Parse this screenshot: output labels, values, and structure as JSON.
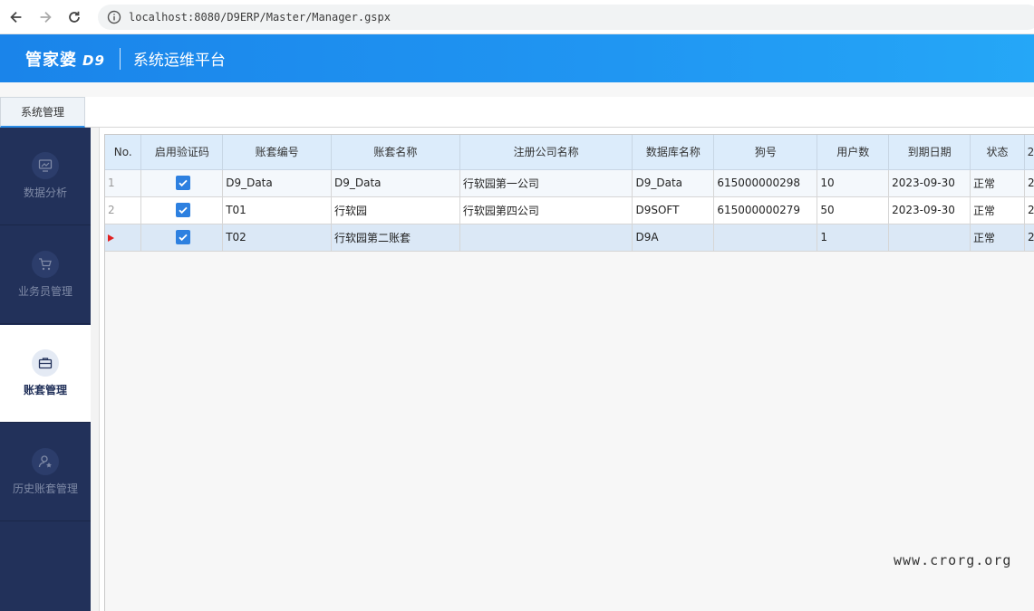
{
  "browser": {
    "url": "localhost:8080/D9ERP/Master/Manager.gspx"
  },
  "header": {
    "logo_text": "管家婆",
    "logo_sub": "D9",
    "title": "系统运维平台"
  },
  "tabs": [
    {
      "label": "系统管理"
    }
  ],
  "sidebar": {
    "items": [
      {
        "label": "数据分析",
        "icon": "monitor-chart-icon"
      },
      {
        "label": "业务员管理",
        "icon": "cart-icon"
      },
      {
        "label": "账套管理",
        "icon": "briefcase-icon",
        "active": true
      },
      {
        "label": "历史账套管理",
        "icon": "user-star-icon"
      }
    ]
  },
  "grid": {
    "columns": [
      "No.",
      "启用验证码",
      "账套编号",
      "账套名称",
      "注册公司名称",
      "数据库名称",
      "狗号",
      "用户数",
      "到期日期",
      "状态",
      "2"
    ],
    "rows": [
      {
        "no": "1",
        "verify": true,
        "code": "D9_Data",
        "name": "D9_Data",
        "company": "行软园第一公司",
        "db": "D9_Data",
        "dongle": "615000000298",
        "users": "10",
        "expiry": "2023-09-30",
        "status": "正常",
        "extra": "2"
      },
      {
        "no": "2",
        "verify": true,
        "code": "T01",
        "name": "行软园",
        "company": "行软园第四公司",
        "db": "D9SOFT",
        "dongle": "615000000279",
        "users": "50",
        "expiry": "2023-09-30",
        "status": "正常",
        "extra": "2"
      },
      {
        "no": "",
        "verify": true,
        "code": "T02",
        "name": "行软园第二账套",
        "company": "",
        "db": "D9A",
        "dongle": "",
        "users": "1",
        "expiry": "",
        "status": "正常",
        "extra": "2",
        "current": true
      }
    ]
  },
  "watermark": "www.crorg.org",
  "colors": {
    "header_blue": "#1a84ea",
    "sidebar_navy": "#22315a",
    "checkbox_blue": "#2d80e0",
    "row_marker_red": "#e02020"
  }
}
